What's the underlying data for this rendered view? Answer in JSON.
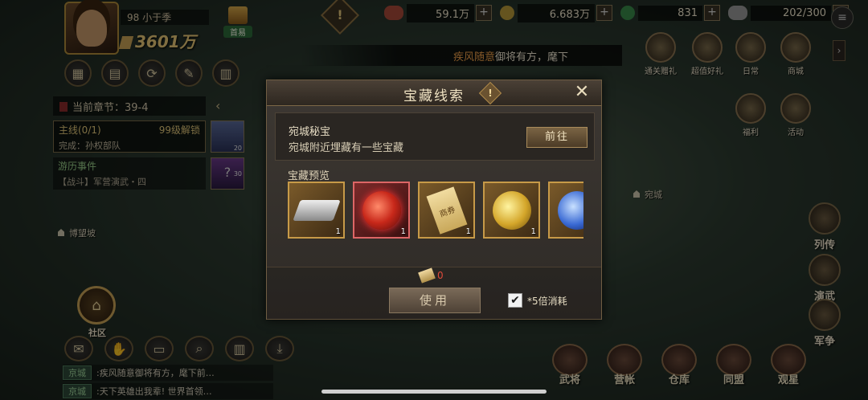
{
  "player": {
    "name": "98 小于季",
    "power": "3601万",
    "gift_label": "首易"
  },
  "resources": [
    {
      "value": "59.1万",
      "color": "#a84a3a"
    },
    {
      "value": "6.683万",
      "color": "#b89a3a"
    },
    {
      "value": "831",
      "color": "#3a8a4a"
    },
    {
      "value": "202/300",
      "color": "#9a9a9a"
    }
  ],
  "ticker": {
    "highlight": "疾风随意",
    "rest": "御将有方，麾下"
  },
  "activities": [
    {
      "label": "通关赠礼"
    },
    {
      "label": "超值好礼"
    },
    {
      "label": "日常"
    },
    {
      "label": "商城"
    },
    {
      "label": "福利"
    },
    {
      "label": "活动"
    }
  ],
  "quest_panel": {
    "chapter": "当前章节：39-4",
    "main_title": "主线(0/1)",
    "main_unlock": "99级解锁",
    "main_desc": "完成：孙权部队",
    "main_count": "20",
    "event_title": "游历事件",
    "event_desc": "【战斗】军营演武・四",
    "event_count": "30"
  },
  "map_labels": {
    "left": "博望坡",
    "right": "宛城"
  },
  "community": {
    "label": "社区"
  },
  "chat": [
    {
      "tag": "京城",
      "msg": ":疾风随意御将有方，麾下前…"
    },
    {
      "tag": "京城",
      "msg": ":天下英雄出我辈! 世界首领…"
    }
  ],
  "side_buttons": [
    {
      "label": "列传"
    },
    {
      "label": "演武"
    },
    {
      "label": "军争"
    }
  ],
  "dock": [
    {
      "label": "武将"
    },
    {
      "label": "营帐"
    },
    {
      "label": "仓库"
    },
    {
      "label": "同盟"
    },
    {
      "label": "观星"
    }
  ],
  "modal": {
    "title": "宝藏线索",
    "info_title": "宛城秘宝",
    "info_desc": "宛城附近埋藏有一些宝藏",
    "go_label": "前往",
    "preview_label": "宝藏预览",
    "items": [
      {
        "name": "silver-ingot",
        "count": "1"
      },
      {
        "name": "red-orb",
        "count": "1"
      },
      {
        "name": "scroll-token",
        "count": "1",
        "text": "商券"
      },
      {
        "name": "gold-orb",
        "count": "1"
      },
      {
        "name": "blue-orb",
        "count": ""
      }
    ],
    "cost_value": "0",
    "use_label": "使用",
    "checkbox_label": "5倍消耗",
    "checkbox_checked": true
  }
}
